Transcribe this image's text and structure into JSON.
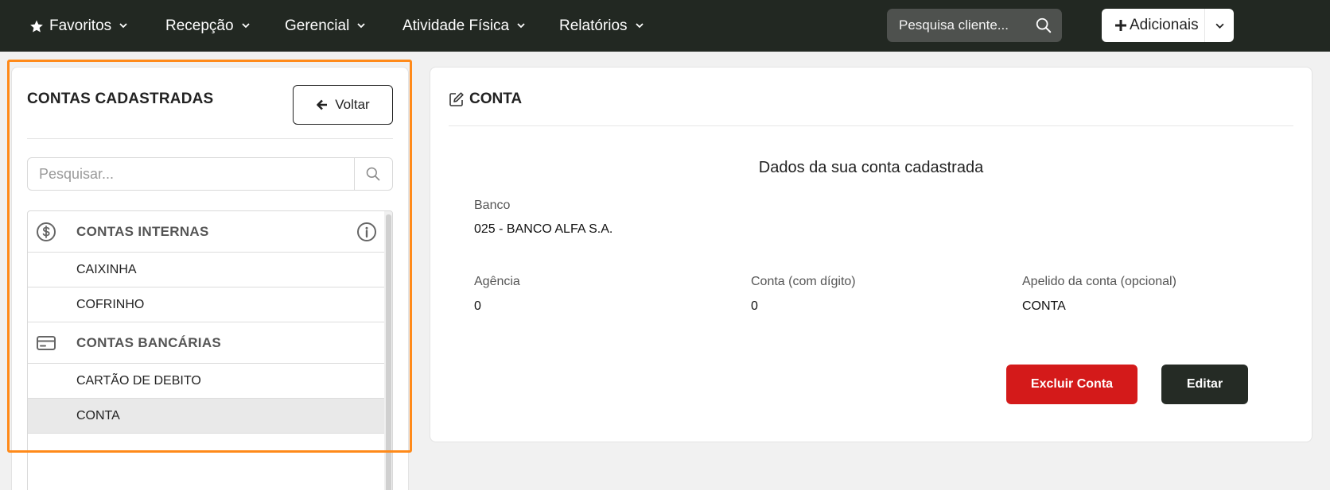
{
  "nav": {
    "items": [
      {
        "label": "Favoritos",
        "icon": "star-icon"
      },
      {
        "label": "Recepção"
      },
      {
        "label": "Gerencial"
      },
      {
        "label": "Atividade Física"
      },
      {
        "label": "Relatórios"
      }
    ],
    "search_placeholder": "Pesquisa cliente...",
    "adicionais_label": "Adicionais"
  },
  "left": {
    "title": "CONTAS CADASTRADAS",
    "back_label": "Voltar",
    "search_placeholder": "Pesquisar...",
    "groups": [
      {
        "label": "CONTAS INTERNAS",
        "icon": "dollar-circle-icon",
        "items": [
          "CAIXINHA",
          "COFRINHO"
        ]
      },
      {
        "label": "CONTAS BANCÁRIAS",
        "icon": "credit-card-icon",
        "items": [
          "CARTÃO DE DEBITO",
          "CONTA"
        ]
      }
    ],
    "selected_item": "CONTA"
  },
  "right": {
    "title": "CONTA",
    "subtitle": "Dados da sua conta cadastrada",
    "fields": {
      "banco": {
        "label": "Banco",
        "value": "025 - BANCO ALFA S.A."
      },
      "agencia": {
        "label": "Agência",
        "value": "0"
      },
      "conta": {
        "label": "Conta (com dígito)",
        "value": "0"
      },
      "apelido": {
        "label": "Apelido da conta (opcional)",
        "value": "CONTA"
      }
    },
    "delete_label": "Excluir Conta",
    "edit_label": "Editar"
  },
  "colors": {
    "topbar": "#222822",
    "highlight": "#ff8a1a",
    "danger": "#d41a1a",
    "dark_button": "#252b25"
  }
}
